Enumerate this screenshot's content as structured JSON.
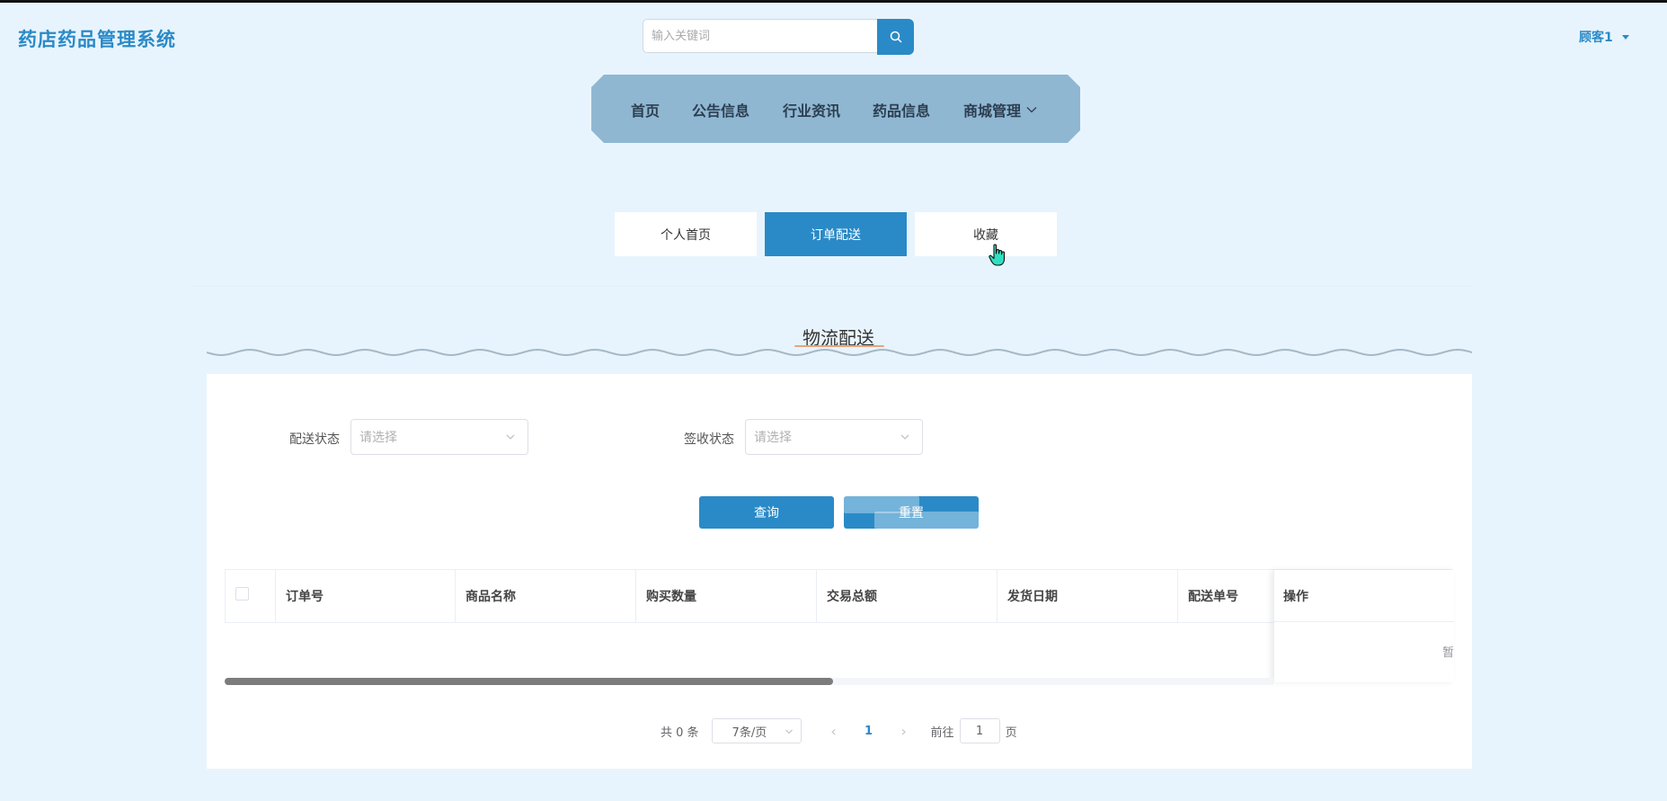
{
  "header": {
    "brand": "药店药品管理系统",
    "search_placeholder": "输入关键词",
    "user": "顾客1"
  },
  "nav": {
    "items": [
      "首页",
      "公告信息",
      "行业资讯",
      "药品信息",
      "商城管理"
    ]
  },
  "tabs": [
    {
      "label": "个人首页",
      "active": false
    },
    {
      "label": "订单配送",
      "active": true
    },
    {
      "label": "收藏",
      "active": false
    }
  ],
  "section_title": "物流配送",
  "filters": {
    "delivery_status_label": "配送状态",
    "delivery_status_placeholder": "请选择",
    "receipt_status_label": "签收状态",
    "receipt_status_placeholder": "请选择"
  },
  "buttons": {
    "query": "查询",
    "reset": "重置"
  },
  "table": {
    "columns": [
      "订单号",
      "商品名称",
      "购买数量",
      "交易总额",
      "发货日期",
      "配送单号",
      "操作"
    ],
    "empty_text": "暂"
  },
  "pagination": {
    "total": "共 0 条",
    "page_size": "7条/页",
    "current_page": "1",
    "goto_prefix": "前往",
    "goto_value": "1",
    "goto_suffix": "页"
  },
  "colors": {
    "primary": "#2a8ac7",
    "nav_bg": "#8fb7d2",
    "page_bg": "#e8f4fd"
  }
}
